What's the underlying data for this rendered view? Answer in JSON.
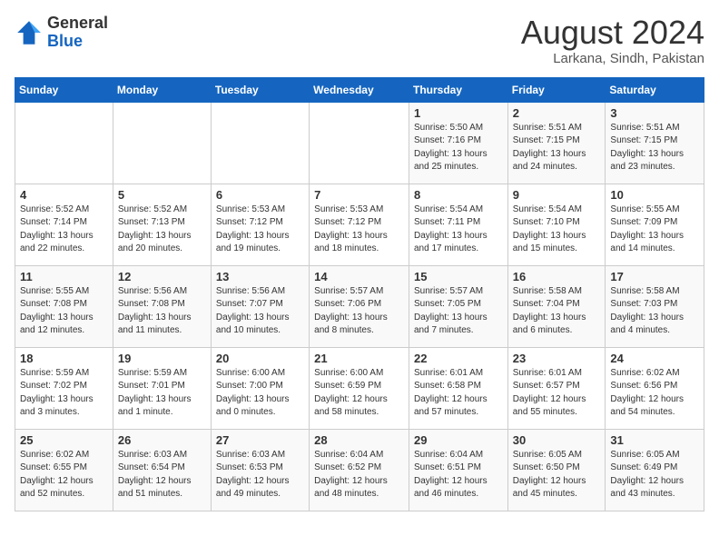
{
  "logo": {
    "general": "General",
    "blue": "Blue"
  },
  "header": {
    "month_year": "August 2024",
    "location": "Larkana, Sindh, Pakistan"
  },
  "days_of_week": [
    "Sunday",
    "Monday",
    "Tuesday",
    "Wednesday",
    "Thursday",
    "Friday",
    "Saturday"
  ],
  "weeks": [
    [
      {
        "day": "",
        "sunrise": "",
        "sunset": "",
        "daylight": ""
      },
      {
        "day": "",
        "sunrise": "",
        "sunset": "",
        "daylight": ""
      },
      {
        "day": "",
        "sunrise": "",
        "sunset": "",
        "daylight": ""
      },
      {
        "day": "",
        "sunrise": "",
        "sunset": "",
        "daylight": ""
      },
      {
        "day": "1",
        "sunrise": "Sunrise: 5:50 AM",
        "sunset": "Sunset: 7:16 PM",
        "daylight": "Daylight: 13 hours and 25 minutes."
      },
      {
        "day": "2",
        "sunrise": "Sunrise: 5:51 AM",
        "sunset": "Sunset: 7:15 PM",
        "daylight": "Daylight: 13 hours and 24 minutes."
      },
      {
        "day": "3",
        "sunrise": "Sunrise: 5:51 AM",
        "sunset": "Sunset: 7:15 PM",
        "daylight": "Daylight: 13 hours and 23 minutes."
      }
    ],
    [
      {
        "day": "4",
        "sunrise": "Sunrise: 5:52 AM",
        "sunset": "Sunset: 7:14 PM",
        "daylight": "Daylight: 13 hours and 22 minutes."
      },
      {
        "day": "5",
        "sunrise": "Sunrise: 5:52 AM",
        "sunset": "Sunset: 7:13 PM",
        "daylight": "Daylight: 13 hours and 20 minutes."
      },
      {
        "day": "6",
        "sunrise": "Sunrise: 5:53 AM",
        "sunset": "Sunset: 7:12 PM",
        "daylight": "Daylight: 13 hours and 19 minutes."
      },
      {
        "day": "7",
        "sunrise": "Sunrise: 5:53 AM",
        "sunset": "Sunset: 7:12 PM",
        "daylight": "Daylight: 13 hours and 18 minutes."
      },
      {
        "day": "8",
        "sunrise": "Sunrise: 5:54 AM",
        "sunset": "Sunset: 7:11 PM",
        "daylight": "Daylight: 13 hours and 17 minutes."
      },
      {
        "day": "9",
        "sunrise": "Sunrise: 5:54 AM",
        "sunset": "Sunset: 7:10 PM",
        "daylight": "Daylight: 13 hours and 15 minutes."
      },
      {
        "day": "10",
        "sunrise": "Sunrise: 5:55 AM",
        "sunset": "Sunset: 7:09 PM",
        "daylight": "Daylight: 13 hours and 14 minutes."
      }
    ],
    [
      {
        "day": "11",
        "sunrise": "Sunrise: 5:55 AM",
        "sunset": "Sunset: 7:08 PM",
        "daylight": "Daylight: 13 hours and 12 minutes."
      },
      {
        "day": "12",
        "sunrise": "Sunrise: 5:56 AM",
        "sunset": "Sunset: 7:08 PM",
        "daylight": "Daylight: 13 hours and 11 minutes."
      },
      {
        "day": "13",
        "sunrise": "Sunrise: 5:56 AM",
        "sunset": "Sunset: 7:07 PM",
        "daylight": "Daylight: 13 hours and 10 minutes."
      },
      {
        "day": "14",
        "sunrise": "Sunrise: 5:57 AM",
        "sunset": "Sunset: 7:06 PM",
        "daylight": "Daylight: 13 hours and 8 minutes."
      },
      {
        "day": "15",
        "sunrise": "Sunrise: 5:57 AM",
        "sunset": "Sunset: 7:05 PM",
        "daylight": "Daylight: 13 hours and 7 minutes."
      },
      {
        "day": "16",
        "sunrise": "Sunrise: 5:58 AM",
        "sunset": "Sunset: 7:04 PM",
        "daylight": "Daylight: 13 hours and 6 minutes."
      },
      {
        "day": "17",
        "sunrise": "Sunrise: 5:58 AM",
        "sunset": "Sunset: 7:03 PM",
        "daylight": "Daylight: 13 hours and 4 minutes."
      }
    ],
    [
      {
        "day": "18",
        "sunrise": "Sunrise: 5:59 AM",
        "sunset": "Sunset: 7:02 PM",
        "daylight": "Daylight: 13 hours and 3 minutes."
      },
      {
        "day": "19",
        "sunrise": "Sunrise: 5:59 AM",
        "sunset": "Sunset: 7:01 PM",
        "daylight": "Daylight: 13 hours and 1 minute."
      },
      {
        "day": "20",
        "sunrise": "Sunrise: 6:00 AM",
        "sunset": "Sunset: 7:00 PM",
        "daylight": "Daylight: 13 hours and 0 minutes."
      },
      {
        "day": "21",
        "sunrise": "Sunrise: 6:00 AM",
        "sunset": "Sunset: 6:59 PM",
        "daylight": "Daylight: 12 hours and 58 minutes."
      },
      {
        "day": "22",
        "sunrise": "Sunrise: 6:01 AM",
        "sunset": "Sunset: 6:58 PM",
        "daylight": "Daylight: 12 hours and 57 minutes."
      },
      {
        "day": "23",
        "sunrise": "Sunrise: 6:01 AM",
        "sunset": "Sunset: 6:57 PM",
        "daylight": "Daylight: 12 hours and 55 minutes."
      },
      {
        "day": "24",
        "sunrise": "Sunrise: 6:02 AM",
        "sunset": "Sunset: 6:56 PM",
        "daylight": "Daylight: 12 hours and 54 minutes."
      }
    ],
    [
      {
        "day": "25",
        "sunrise": "Sunrise: 6:02 AM",
        "sunset": "Sunset: 6:55 PM",
        "daylight": "Daylight: 12 hours and 52 minutes."
      },
      {
        "day": "26",
        "sunrise": "Sunrise: 6:03 AM",
        "sunset": "Sunset: 6:54 PM",
        "daylight": "Daylight: 12 hours and 51 minutes."
      },
      {
        "day": "27",
        "sunrise": "Sunrise: 6:03 AM",
        "sunset": "Sunset: 6:53 PM",
        "daylight": "Daylight: 12 hours and 49 minutes."
      },
      {
        "day": "28",
        "sunrise": "Sunrise: 6:04 AM",
        "sunset": "Sunset: 6:52 PM",
        "daylight": "Daylight: 12 hours and 48 minutes."
      },
      {
        "day": "29",
        "sunrise": "Sunrise: 6:04 AM",
        "sunset": "Sunset: 6:51 PM",
        "daylight": "Daylight: 12 hours and 46 minutes."
      },
      {
        "day": "30",
        "sunrise": "Sunrise: 6:05 AM",
        "sunset": "Sunset: 6:50 PM",
        "daylight": "Daylight: 12 hours and 45 minutes."
      },
      {
        "day": "31",
        "sunrise": "Sunrise: 6:05 AM",
        "sunset": "Sunset: 6:49 PM",
        "daylight": "Daylight: 12 hours and 43 minutes."
      }
    ]
  ]
}
